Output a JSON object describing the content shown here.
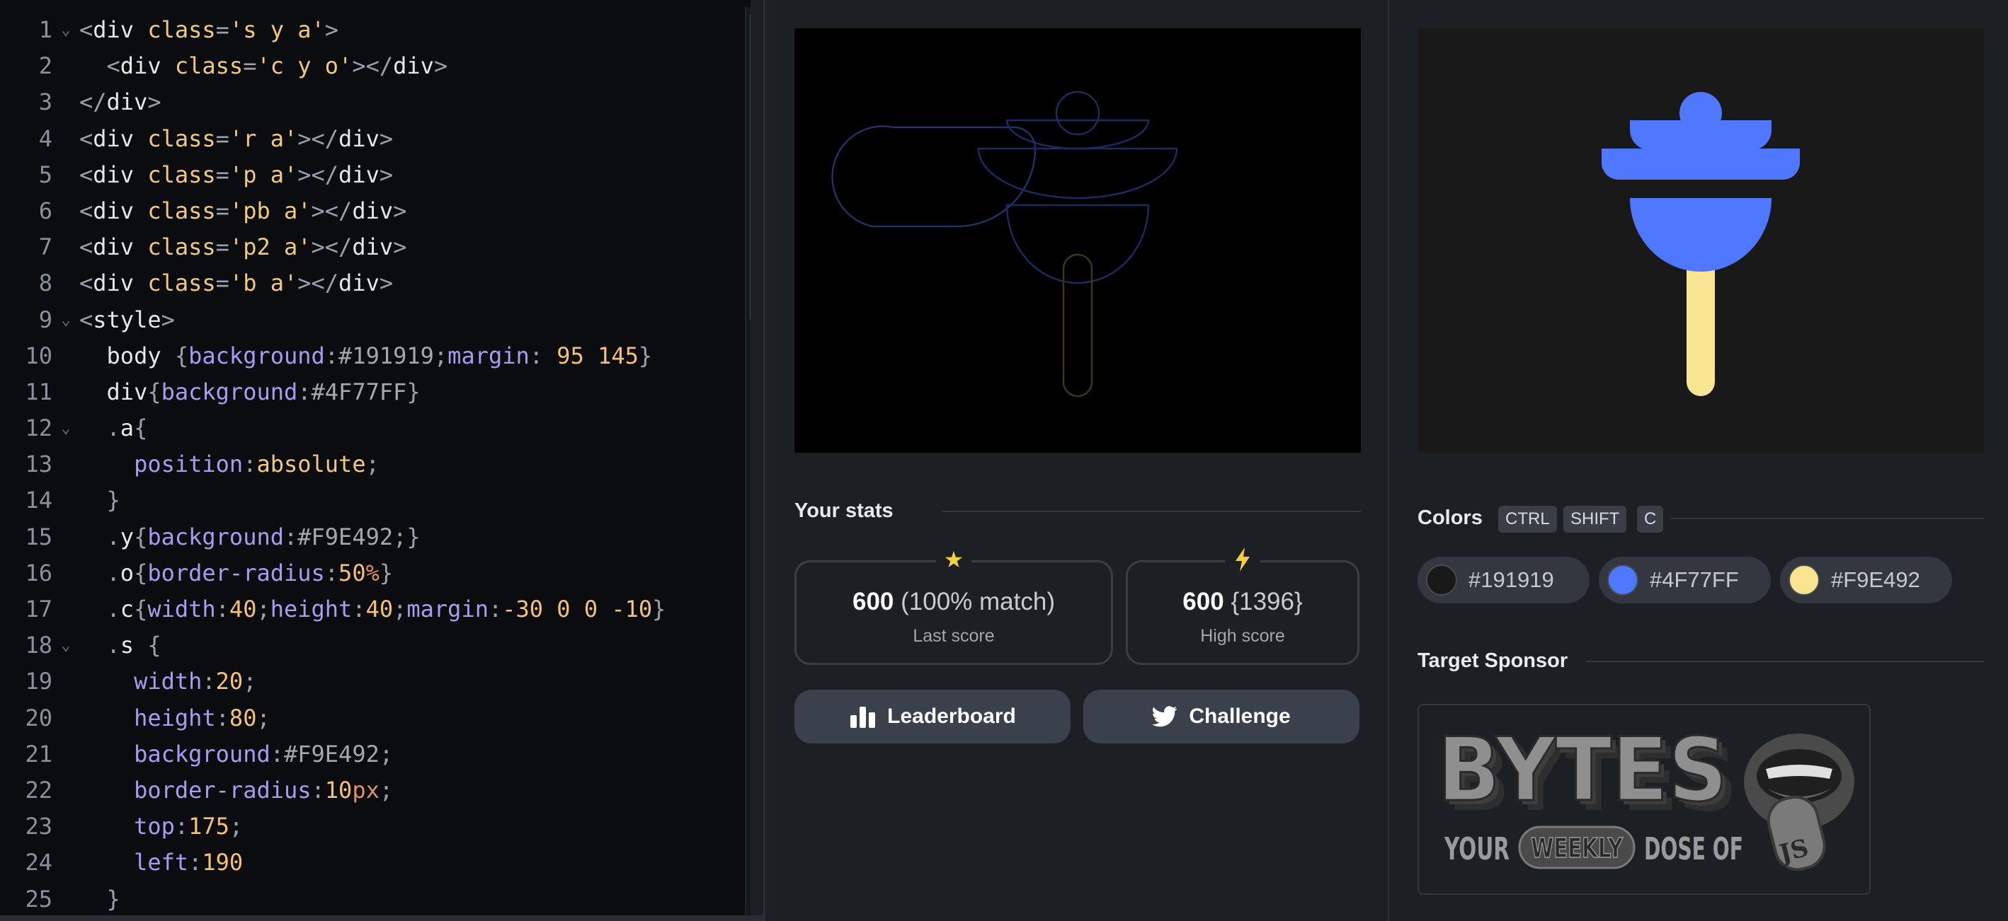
{
  "editor": {
    "lines": [
      {
        "n": "1",
        "fold": true,
        "tokens": [
          [
            "punct",
            "<"
          ],
          [
            "tag",
            "div "
          ],
          [
            "attr",
            "class"
          ],
          [
            "punct",
            "="
          ],
          [
            "str",
            "'s y a'"
          ],
          [
            "punct",
            ">"
          ]
        ]
      },
      {
        "n": "2",
        "fold": false,
        "tokens": [
          [
            "plain",
            "  "
          ],
          [
            "punct",
            "<"
          ],
          [
            "tag",
            "div "
          ],
          [
            "attr",
            "class"
          ],
          [
            "punct",
            "="
          ],
          [
            "str",
            "'c y o'"
          ],
          [
            "punct",
            "></"
          ],
          [
            "tag",
            "div"
          ],
          [
            "punct",
            ">"
          ]
        ]
      },
      {
        "n": "3",
        "fold": false,
        "tokens": [
          [
            "punct",
            "</"
          ],
          [
            "tag",
            "div"
          ],
          [
            "punct",
            ">"
          ]
        ]
      },
      {
        "n": "4",
        "fold": false,
        "tokens": [
          [
            "punct",
            "<"
          ],
          [
            "tag",
            "div "
          ],
          [
            "attr",
            "class"
          ],
          [
            "punct",
            "="
          ],
          [
            "str",
            "'r a'"
          ],
          [
            "punct",
            "></"
          ],
          [
            "tag",
            "div"
          ],
          [
            "punct",
            ">"
          ]
        ]
      },
      {
        "n": "5",
        "fold": false,
        "tokens": [
          [
            "punct",
            "<"
          ],
          [
            "tag",
            "div "
          ],
          [
            "attr",
            "class"
          ],
          [
            "punct",
            "="
          ],
          [
            "str",
            "'p a'"
          ],
          [
            "punct",
            "></"
          ],
          [
            "tag",
            "div"
          ],
          [
            "punct",
            ">"
          ]
        ]
      },
      {
        "n": "6",
        "fold": false,
        "tokens": [
          [
            "punct",
            "<"
          ],
          [
            "tag",
            "div "
          ],
          [
            "attr",
            "class"
          ],
          [
            "punct",
            "="
          ],
          [
            "str",
            "'pb a'"
          ],
          [
            "punct",
            "></"
          ],
          [
            "tag",
            "div"
          ],
          [
            "punct",
            ">"
          ]
        ]
      },
      {
        "n": "7",
        "fold": false,
        "tokens": [
          [
            "punct",
            "<"
          ],
          [
            "tag",
            "div "
          ],
          [
            "attr",
            "class"
          ],
          [
            "punct",
            "="
          ],
          [
            "str",
            "'p2 a'"
          ],
          [
            "punct",
            "></"
          ],
          [
            "tag",
            "div"
          ],
          [
            "punct",
            ">"
          ]
        ]
      },
      {
        "n": "8",
        "fold": false,
        "tokens": [
          [
            "punct",
            "<"
          ],
          [
            "tag",
            "div "
          ],
          [
            "attr",
            "class"
          ],
          [
            "punct",
            "="
          ],
          [
            "str",
            "'b a'"
          ],
          [
            "punct",
            "></"
          ],
          [
            "tag",
            "div"
          ],
          [
            "punct",
            ">"
          ]
        ]
      },
      {
        "n": "9",
        "fold": true,
        "tokens": [
          [
            "punct",
            "<"
          ],
          [
            "tag",
            "style"
          ],
          [
            "punct",
            ">"
          ]
        ]
      },
      {
        "n": "10",
        "fold": false,
        "tokens": [
          [
            "plain",
            "  "
          ],
          [
            "sel",
            "body "
          ],
          [
            "punct",
            "{"
          ],
          [
            "prop",
            "background"
          ],
          [
            "punct",
            ":"
          ],
          [
            "val",
            "#191919"
          ],
          [
            "punct",
            ";"
          ],
          [
            "prop",
            "margin"
          ],
          [
            "punct",
            ": "
          ],
          [
            "num",
            "95 145"
          ],
          [
            "punct",
            "}"
          ]
        ]
      },
      {
        "n": "11",
        "fold": false,
        "tokens": [
          [
            "plain",
            "  "
          ],
          [
            "sel",
            "div"
          ],
          [
            "punct",
            "{"
          ],
          [
            "prop",
            "background"
          ],
          [
            "punct",
            ":"
          ],
          [
            "val",
            "#4F77FF"
          ],
          [
            "punct",
            "}"
          ]
        ]
      },
      {
        "n": "12",
        "fold": true,
        "tokens": [
          [
            "plain",
            "  "
          ],
          [
            "punct",
            "."
          ],
          [
            "sel",
            "a"
          ],
          [
            "punct",
            "{"
          ]
        ]
      },
      {
        "n": "13",
        "fold": false,
        "tokens": [
          [
            "plain",
            "    "
          ],
          [
            "prop",
            "position"
          ],
          [
            "punct",
            ":"
          ],
          [
            "attr",
            "absolute"
          ],
          [
            "punct",
            ";"
          ]
        ]
      },
      {
        "n": "14",
        "fold": false,
        "tokens": [
          [
            "plain",
            "  "
          ],
          [
            "punct",
            "}"
          ]
        ]
      },
      {
        "n": "15",
        "fold": false,
        "tokens": [
          [
            "plain",
            "  "
          ],
          [
            "punct",
            "."
          ],
          [
            "sel",
            "y"
          ],
          [
            "punct",
            "{"
          ],
          [
            "prop",
            "background"
          ],
          [
            "punct",
            ":"
          ],
          [
            "val",
            "#F9E492"
          ],
          [
            "punct",
            ";}"
          ]
        ]
      },
      {
        "n": "16",
        "fold": false,
        "tokens": [
          [
            "plain",
            "  "
          ],
          [
            "punct",
            "."
          ],
          [
            "sel",
            "o"
          ],
          [
            "punct",
            "{"
          ],
          [
            "prop",
            "border-radius"
          ],
          [
            "punct",
            ":"
          ],
          [
            "num",
            "50"
          ],
          [
            "unit",
            "%"
          ],
          [
            "punct",
            "}"
          ]
        ]
      },
      {
        "n": "17",
        "fold": false,
        "tokens": [
          [
            "plain",
            "  "
          ],
          [
            "punct",
            "."
          ],
          [
            "sel",
            "c"
          ],
          [
            "punct",
            "{"
          ],
          [
            "prop",
            "width"
          ],
          [
            "punct",
            ":"
          ],
          [
            "num",
            "40"
          ],
          [
            "punct",
            ";"
          ],
          [
            "prop",
            "height"
          ],
          [
            "punct",
            ":"
          ],
          [
            "num",
            "40"
          ],
          [
            "punct",
            ";"
          ],
          [
            "prop",
            "margin"
          ],
          [
            "punct",
            ":"
          ],
          [
            "num",
            "-30 0 0 -10"
          ],
          [
            "punct",
            "}"
          ]
        ]
      },
      {
        "n": "18",
        "fold": true,
        "tokens": [
          [
            "plain",
            "  "
          ],
          [
            "punct",
            "."
          ],
          [
            "sel",
            "s "
          ],
          [
            "punct",
            "{"
          ]
        ]
      },
      {
        "n": "19",
        "fold": false,
        "tokens": [
          [
            "plain",
            "    "
          ],
          [
            "prop",
            "width"
          ],
          [
            "punct",
            ":"
          ],
          [
            "num",
            "20"
          ],
          [
            "punct",
            ";"
          ]
        ]
      },
      {
        "n": "20",
        "fold": false,
        "tokens": [
          [
            "plain",
            "    "
          ],
          [
            "prop",
            "height"
          ],
          [
            "punct",
            ":"
          ],
          [
            "num",
            "80"
          ],
          [
            "punct",
            ";"
          ]
        ]
      },
      {
        "n": "21",
        "fold": false,
        "tokens": [
          [
            "plain",
            "    "
          ],
          [
            "prop",
            "background"
          ],
          [
            "punct",
            ":"
          ],
          [
            "val",
            "#F9E492"
          ],
          [
            "punct",
            ";"
          ]
        ]
      },
      {
        "n": "22",
        "fold": false,
        "tokens": [
          [
            "plain",
            "    "
          ],
          [
            "prop",
            "border-radius"
          ],
          [
            "punct",
            ":"
          ],
          [
            "num",
            "10"
          ],
          [
            "unit",
            "px"
          ],
          [
            "punct",
            ";"
          ]
        ]
      },
      {
        "n": "23",
        "fold": false,
        "tokens": [
          [
            "plain",
            "    "
          ],
          [
            "prop",
            "top"
          ],
          [
            "punct",
            ":"
          ],
          [
            "num",
            "175"
          ],
          [
            "punct",
            ";"
          ]
        ]
      },
      {
        "n": "24",
        "fold": false,
        "tokens": [
          [
            "plain",
            "    "
          ],
          [
            "prop",
            "left"
          ],
          [
            "punct",
            ":"
          ],
          [
            "num",
            "190"
          ]
        ]
      },
      {
        "n": "25",
        "fold": false,
        "tokens": [
          [
            "plain",
            "  "
          ],
          [
            "punct",
            "}"
          ]
        ]
      }
    ]
  },
  "stats": {
    "title": "Your stats",
    "last": {
      "score": "600",
      "detail": "(100% match)",
      "label": "Last score",
      "icon": "star-icon"
    },
    "high": {
      "score": "600",
      "detail": "{1396}",
      "label": "High score",
      "icon": "lightning-icon"
    }
  },
  "buttons": {
    "leaderboard": "Leaderboard",
    "challenge": "Challenge"
  },
  "colors": {
    "title": "Colors",
    "shortcut": [
      "CTRL",
      "SHIFT",
      "C"
    ],
    "swatches": [
      {
        "hex": "#191919"
      },
      {
        "hex": "#4F77FF"
      },
      {
        "hex": "#F9E492"
      }
    ]
  },
  "sponsor": {
    "title": "Target Sponsor",
    "brand": "BYTES",
    "your": "YOUR",
    "weekly": "WEEKLY",
    "dose": "DOSE OF",
    "js": "JS"
  },
  "palette": {
    "background": "#191919",
    "blue": "#4F77FF",
    "yellow": "#F9E492"
  }
}
